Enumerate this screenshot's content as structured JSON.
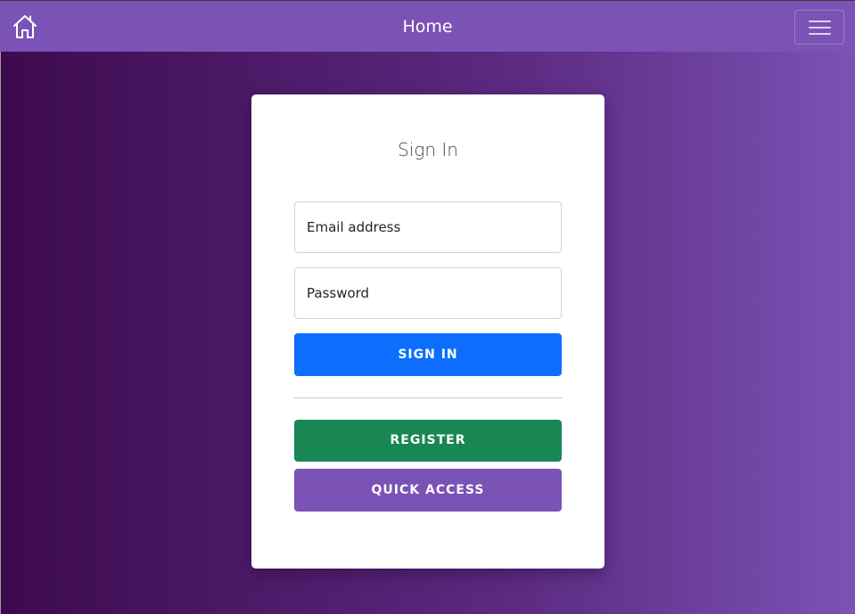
{
  "header": {
    "title": "Home",
    "home_icon": "home-icon",
    "menu_icon": "hamburger-menu-icon",
    "background_color": "#7b52b5"
  },
  "signin_card": {
    "title": "Sign In",
    "email_placeholder": "Email address",
    "password_placeholder": "Password",
    "signin_label": "SIGN IN",
    "register_label": "REGISTER",
    "quick_access_label": "QUICK ACCESS"
  },
  "colors": {
    "signin_button": "#0d6efd",
    "register_button": "#198754",
    "quick_access_button": "#7b52b5",
    "background_gradient_start": "#3d0a4f",
    "background_gradient_end": "#7b52b5"
  }
}
